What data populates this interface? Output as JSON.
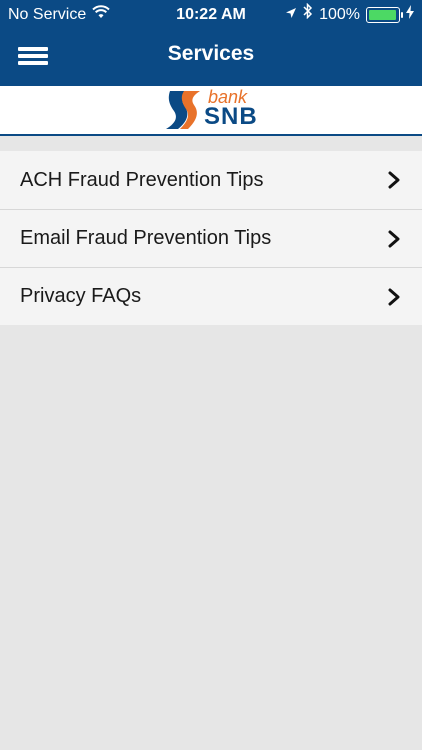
{
  "status_bar": {
    "carrier": "No Service",
    "time": "10:22 AM",
    "battery": "100%"
  },
  "nav": {
    "title": "Services"
  },
  "logo": {
    "bank": "bank",
    "snb": "SNB"
  },
  "list": {
    "items": [
      {
        "label": "ACH Fraud Prevention Tips"
      },
      {
        "label": "Email Fraud Prevention Tips"
      },
      {
        "label": "Privacy FAQs"
      }
    ]
  },
  "colors": {
    "header": "#0b4a85",
    "accent_orange": "#e8722a",
    "list_bg": "#f4f4f4",
    "page_bg": "#e6e6e6"
  }
}
